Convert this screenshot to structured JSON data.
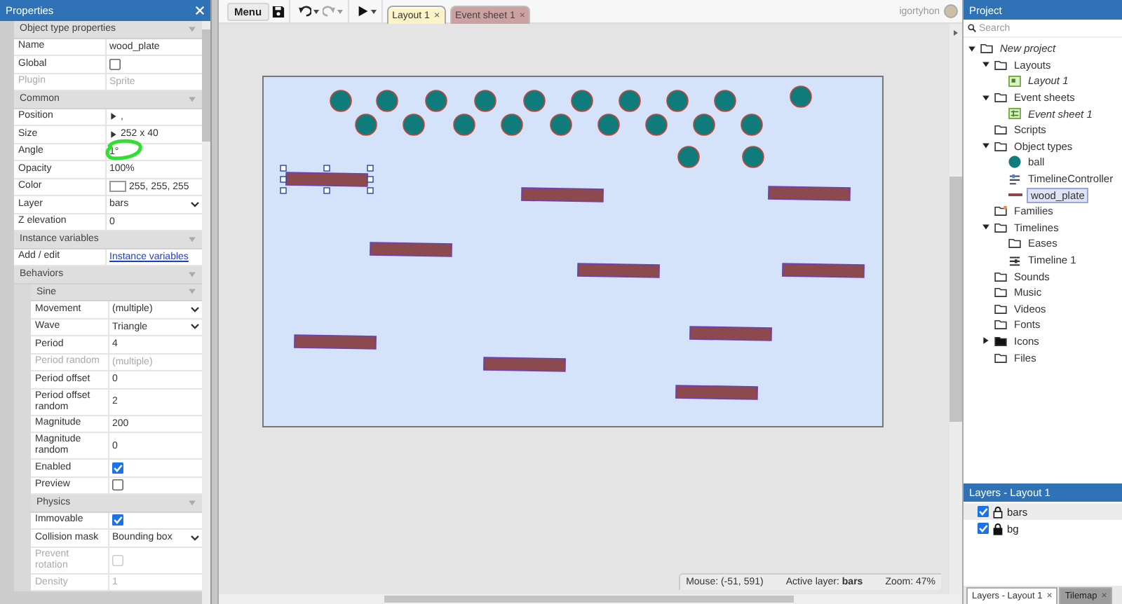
{
  "properties_panel": {
    "title": "Properties",
    "sections": [
      {
        "title": "Object type properties",
        "expanded": true,
        "rows": [
          {
            "label": "Name",
            "kind": "text",
            "value": "wood_plate",
            "disabled": false
          },
          {
            "label": "Global",
            "kind": "checkbox",
            "checked": false,
            "disabled": false
          },
          {
            "label": "Plugin",
            "kind": "text",
            "value": "Sprite",
            "disabled": true
          }
        ]
      },
      {
        "title": "Common",
        "expanded": true,
        "rows": [
          {
            "label": "Position",
            "kind": "expander",
            "value": ",",
            "disabled": false
          },
          {
            "label": "Size",
            "kind": "expander",
            "value": "252 x 40",
            "disabled": false
          },
          {
            "label": "Angle",
            "kind": "text",
            "value": "1°",
            "disabled": false,
            "highlighted": true
          },
          {
            "label": "Opacity",
            "kind": "text",
            "value": "100%",
            "disabled": false
          },
          {
            "label": "Color",
            "kind": "color",
            "value": "255, 255, 255",
            "color": "#ffffff",
            "disabled": false
          },
          {
            "label": "Layer",
            "kind": "dropdown",
            "value": "bars",
            "disabled": false
          },
          {
            "label": "Z elevation",
            "kind": "text",
            "value": "0",
            "disabled": false
          }
        ]
      },
      {
        "title": "Instance variables",
        "expanded": true,
        "rows": [
          {
            "label": "Add / edit",
            "kind": "link",
            "value": "Instance variables",
            "disabled": false
          }
        ]
      },
      {
        "title": "Behaviors",
        "expanded": true,
        "subsections": [
          {
            "title": "Sine",
            "expanded": true,
            "rows": [
              {
                "label": "Movement",
                "kind": "dropdown",
                "value": "(multiple)",
                "disabled": false
              },
              {
                "label": "Wave",
                "kind": "dropdown",
                "value": "Triangle",
                "disabled": false
              },
              {
                "label": "Period",
                "kind": "text",
                "value": "4",
                "disabled": false
              },
              {
                "label": "Period random",
                "kind": "text",
                "value": "(multiple)",
                "disabled": true
              },
              {
                "label": "Period offset",
                "kind": "text",
                "value": "0",
                "disabled": false
              },
              {
                "label": "Period offset random",
                "kind": "text",
                "value": "2",
                "disabled": false
              },
              {
                "label": "Magnitude",
                "kind": "text",
                "value": "200",
                "disabled": false
              },
              {
                "label": "Magnitude random",
                "kind": "text",
                "value": "0",
                "disabled": false
              },
              {
                "label": "Enabled",
                "kind": "checkbox",
                "checked": true,
                "disabled": false
              },
              {
                "label": "Preview",
                "kind": "checkbox",
                "checked": false,
                "disabled": false
              }
            ]
          },
          {
            "title": "Physics",
            "expanded": true,
            "rows": [
              {
                "label": "Immovable",
                "kind": "checkbox",
                "checked": true,
                "disabled": false
              },
              {
                "label": "Collision mask",
                "kind": "dropdown",
                "value": "Bounding box",
                "disabled": false
              },
              {
                "label": "Prevent rotation",
                "kind": "checkbox",
                "checked": false,
                "disabled": true
              },
              {
                "label": "Density",
                "kind": "text",
                "value": "1",
                "disabled": true
              }
            ]
          }
        ]
      }
    ]
  },
  "toolbar": {
    "menu_label": "Menu",
    "undo_disabled": false,
    "redo_disabled": true,
    "tabs": [
      {
        "label": "Layout 1",
        "kind": "layout",
        "selected": true,
        "close": "×"
      },
      {
        "label": "Event sheet 1",
        "kind": "events",
        "selected": false,
        "close": "×"
      }
    ],
    "user": "igortyhon"
  },
  "status_bar": {
    "mouse": "Mouse: (-51, 591)",
    "active_layer": "Active layer: **bars**",
    "zoom": "Zoom: 47%"
  },
  "project_panel": {
    "title": "Project",
    "search_placeholder": "Search",
    "tree": [
      {
        "label": "New project",
        "kind": "folder",
        "italic": true,
        "expanded": true,
        "selected": false,
        "children": [
          {
            "label": "Layouts",
            "kind": "folder",
            "italic": false,
            "expanded": true,
            "selected": false,
            "children": [
              {
                "label": "Layout 1",
                "kind": "layout",
                "italic": true,
                "selected": false
              }
            ]
          },
          {
            "label": "Event sheets",
            "kind": "folder",
            "italic": false,
            "expanded": true,
            "selected": false,
            "children": [
              {
                "label": "Event sheet 1",
                "kind": "events",
                "italic": true,
                "selected": false
              }
            ]
          },
          {
            "label": "Scripts",
            "kind": "folder",
            "italic": false,
            "selected": false
          },
          {
            "label": "Object types",
            "kind": "folder",
            "italic": false,
            "expanded": true,
            "selected": false,
            "children": [
              {
                "label": "ball",
                "kind": "sprite",
                "italic": false,
                "selected": false
              },
              {
                "label": "TimelineController",
                "kind": "controller",
                "italic": false,
                "selected": false
              },
              {
                "label": "wood_plate",
                "kind": "sprite",
                "italic": false,
                "selected": true
              }
            ]
          },
          {
            "label": "Families",
            "kind": "folder",
            "italic": false,
            "selected": false
          },
          {
            "label": "Timelines",
            "kind": "folder",
            "italic": false,
            "expanded": true,
            "selected": false,
            "children": [
              {
                "label": "Eases",
                "kind": "folder",
                "italic": false,
                "selected": false
              },
              {
                "label": "Timeline 1",
                "kind": "timeline",
                "italic": false,
                "selected": false
              }
            ]
          },
          {
            "label": "Sounds",
            "kind": "folder",
            "italic": false,
            "selected": false
          },
          {
            "label": "Music",
            "kind": "folder",
            "italic": false,
            "selected": false
          },
          {
            "label": "Videos",
            "kind": "folder",
            "italic": false,
            "selected": false
          },
          {
            "label": "Fonts",
            "kind": "folder",
            "italic": false,
            "selected": false
          },
          {
            "label": "Icons",
            "kind": "folder",
            "italic": false,
            "expanded": false,
            "selected": false
          },
          {
            "label": "Files",
            "kind": "folder",
            "italic": false,
            "selected": false
          }
        ]
      }
    ]
  },
  "layers_panel": {
    "title": "Layers - Layout 1",
    "layers": [
      {
        "name": "bars",
        "visible": true,
        "locked": false,
        "selected": true
      },
      {
        "name": "bg",
        "visible": true,
        "locked": true,
        "selected": false
      }
    ]
  },
  "bottom_tabs": [
    {
      "label": "Layers - Layout 1",
      "selected": true,
      "close": "×"
    },
    {
      "label": "Tilemap",
      "selected": false,
      "close": "×"
    }
  ]
}
